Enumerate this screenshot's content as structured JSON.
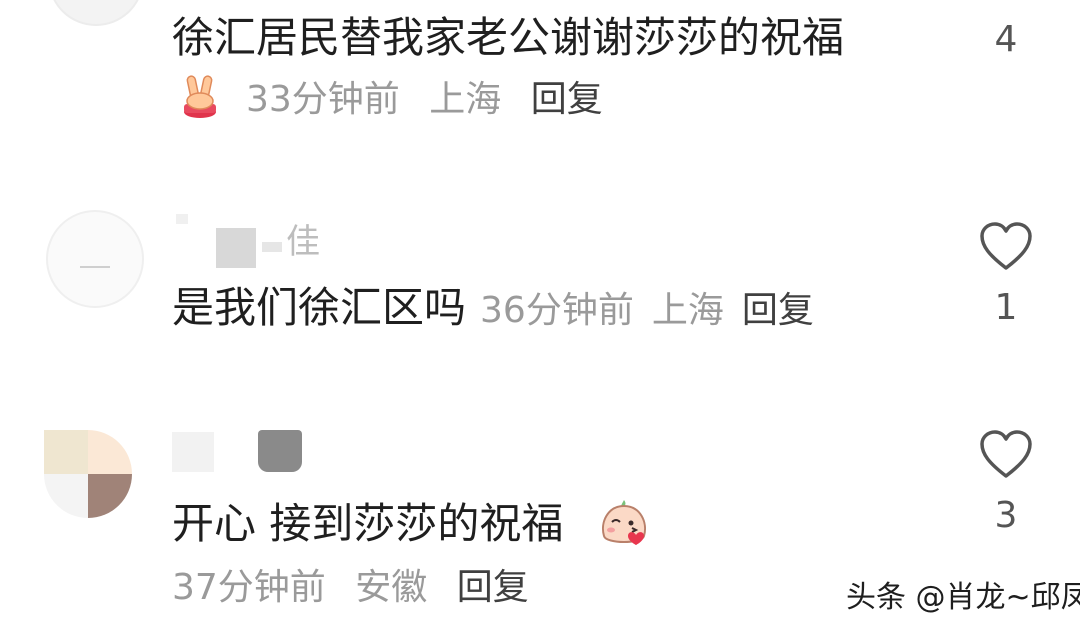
{
  "comments": [
    {
      "text": "徐汇居民替我家老公谢谢莎莎的祝福",
      "emoji": "victory-hand-emoji",
      "time": "33分钟前",
      "location": "上海",
      "reply": "回复",
      "likes": "4"
    },
    {
      "username_fragment": "佳",
      "text": "是我们徐汇区吗",
      "time": "36分钟前",
      "location": "上海",
      "reply": "回复",
      "likes": "1"
    },
    {
      "text": "开心 接到莎莎的祝福",
      "emoji": "blowing-kiss-emoji",
      "time": "37分钟前",
      "location": "安徽",
      "reply": "回复",
      "likes": "3"
    }
  ],
  "watermark": "头条 @肖龙~邱凤",
  "colors": {
    "text": "#1f1f1f",
    "meta": "#9a9a9a",
    "reply": "#404040",
    "heart_outline": "#555555"
  }
}
